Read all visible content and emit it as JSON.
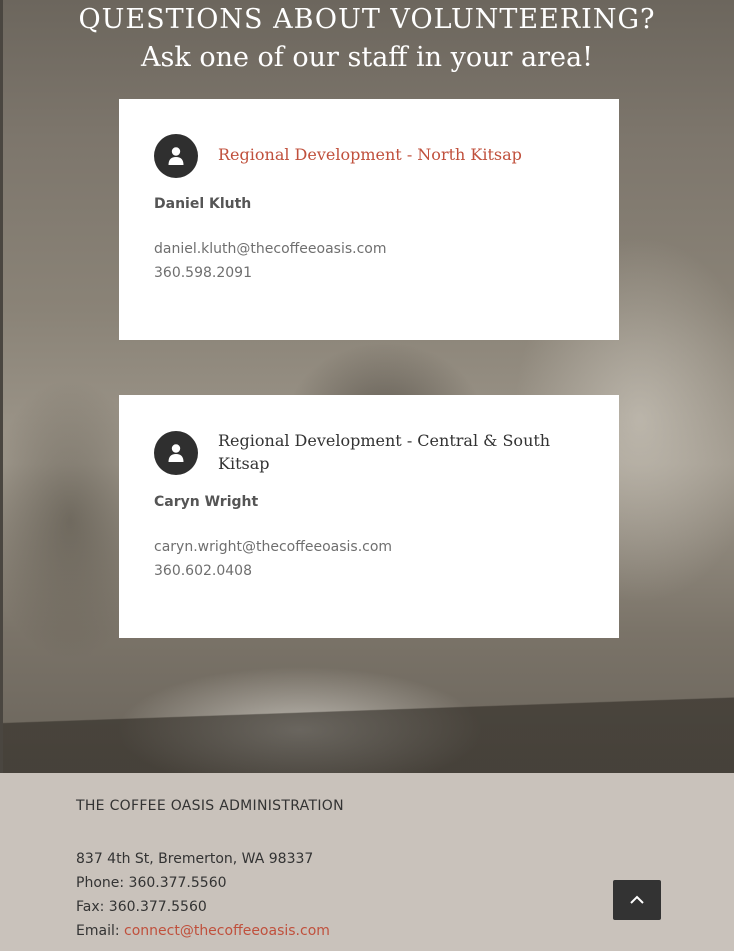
{
  "hero": {
    "heading_line1": "QUESTIONS ABOUT VOLUNTEERING?",
    "heading_line2": "Ask one of our staff in your area!"
  },
  "cards": [
    {
      "icon": "user-icon",
      "title": "Regional Development - North Kitsap",
      "name": "Daniel Kluth",
      "email": "daniel.kluth@thecoffeeoasis.com",
      "phone": "360.598.2091"
    },
    {
      "icon": "user-icon",
      "title": "Regional Development - Central & South Kitsap",
      "name": "Caryn Wright",
      "email": "caryn.wright@thecoffeeoasis.com",
      "phone": "360.602.0408"
    }
  ],
  "footer": {
    "title": "THE COFFEE OASIS ADMINISTRATION",
    "address": "837 4th St, Bremerton, WA 98337",
    "phone": "Phone: 360.377.5560",
    "fax": "Fax: 360.377.5560",
    "email_label": "Email: ",
    "email_link": "connect@thecoffeeoasis.com"
  },
  "to_top_icon": "chevron-up-icon",
  "colors": {
    "accent": "#c0503c",
    "footer_bg": "#c9c2bb",
    "dark": "#333333"
  }
}
